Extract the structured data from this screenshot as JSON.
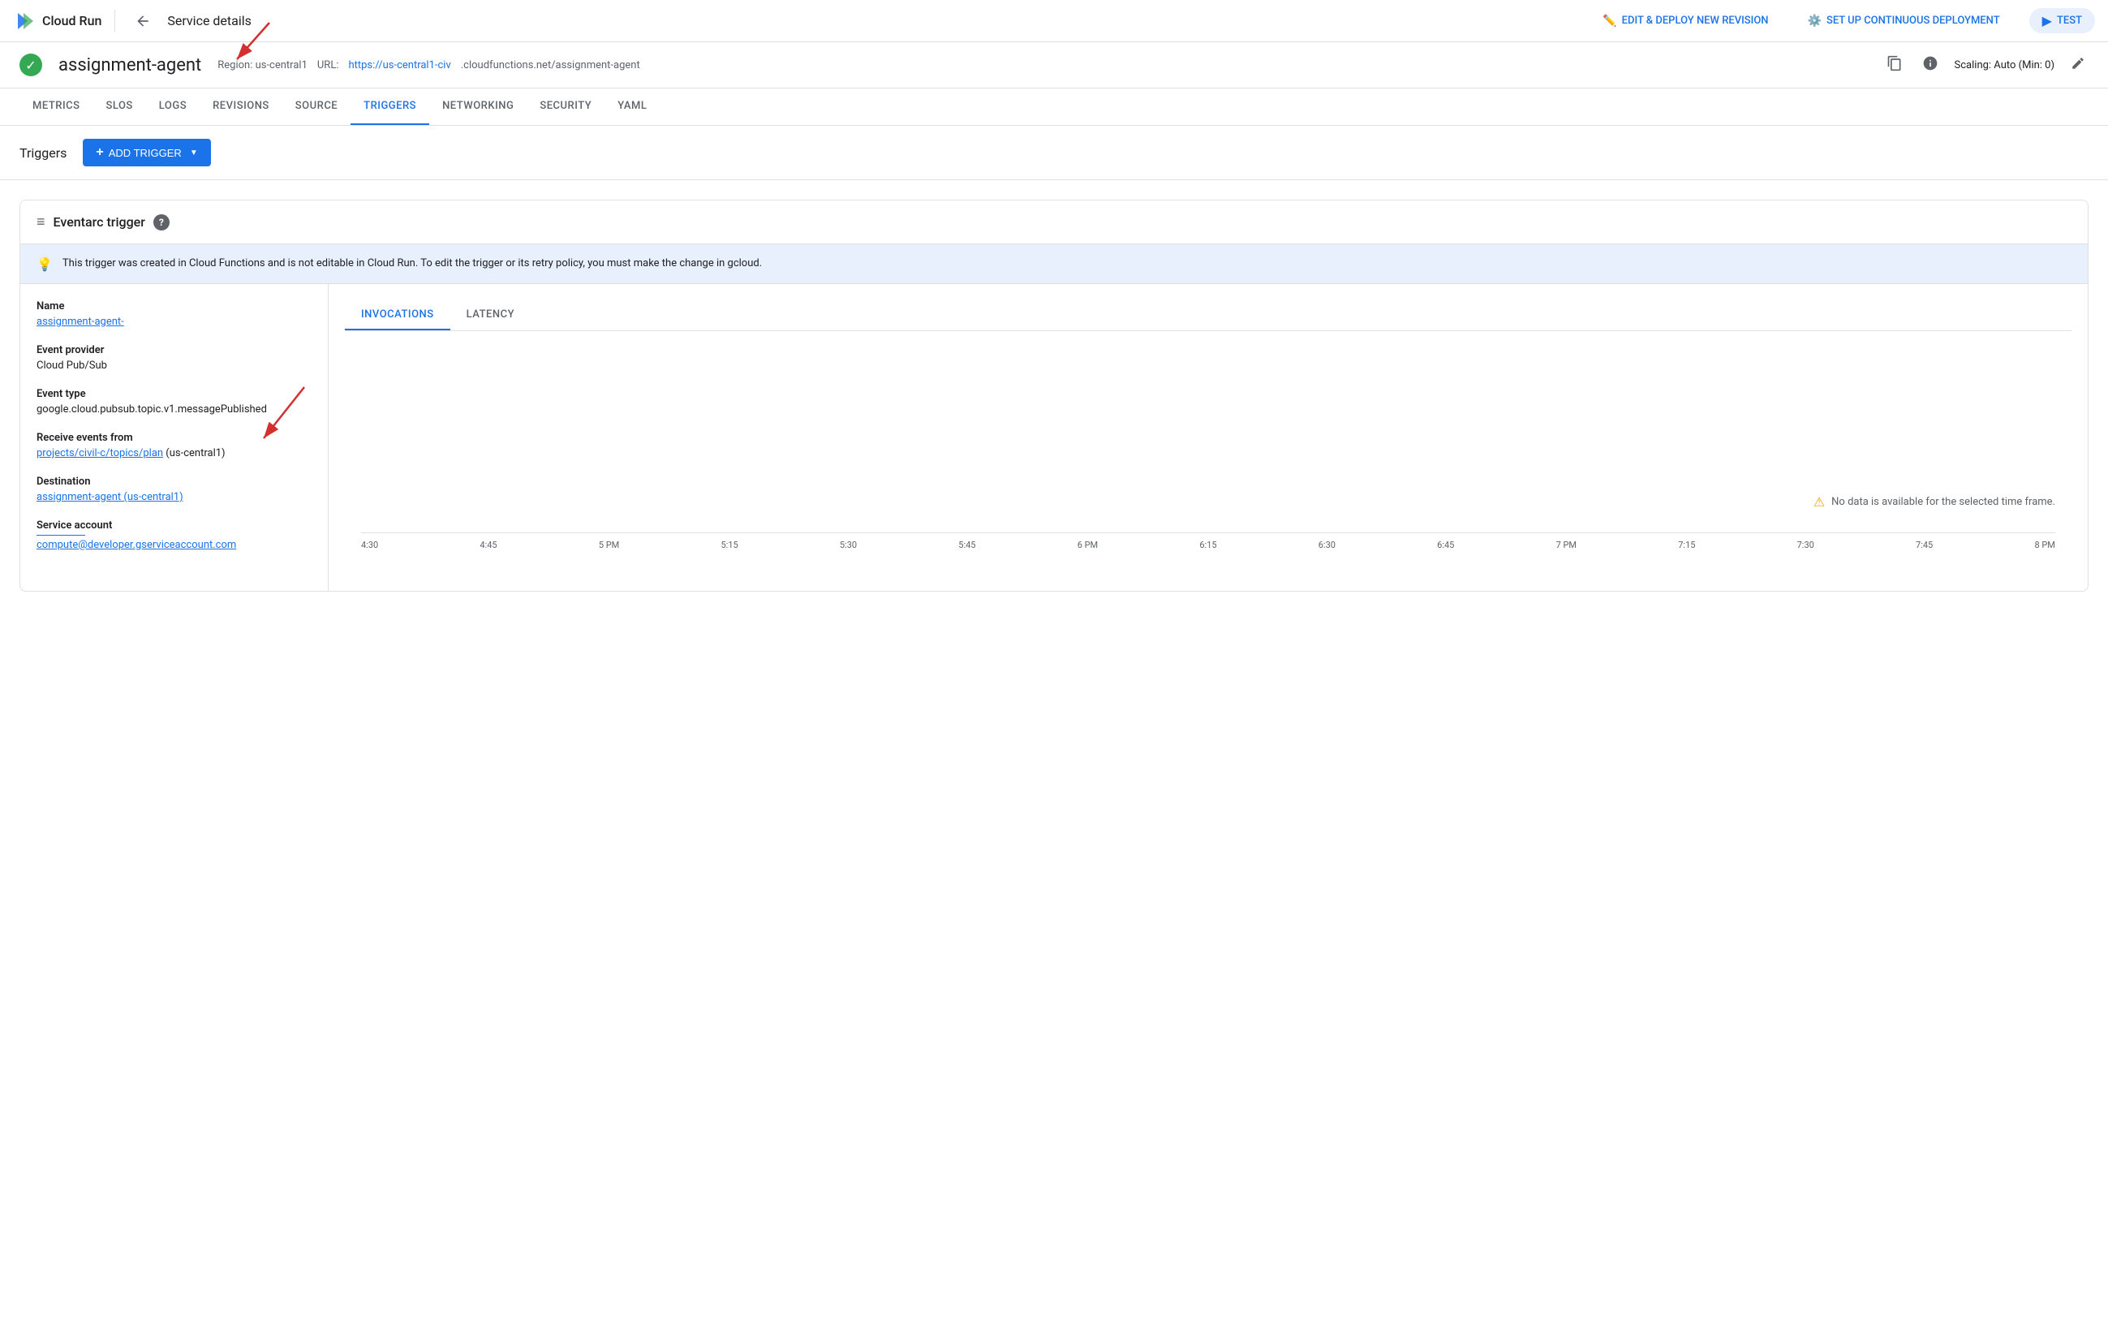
{
  "topNav": {
    "appName": "Cloud Run",
    "pageTitle": "Service details",
    "backAriaLabel": "Back",
    "actions": [
      {
        "id": "edit-deploy",
        "label": "EDIT & DEPLOY NEW REVISION",
        "icon": "✏️"
      },
      {
        "id": "continuous-deploy",
        "label": "SET UP CONTINUOUS DEPLOYMENT",
        "icon": "⚙️"
      },
      {
        "id": "test",
        "label": "TEST",
        "icon": "▶"
      }
    ]
  },
  "service": {
    "name": "assignment-agent",
    "status": "healthy",
    "region": "Region: us-central1",
    "urlLabel": "URL:",
    "urlDisplay": "https://us-central1-civ",
    "urlSuffix": ".cloudfunctions.net/assignment-agent",
    "scaling": "Scaling: Auto (Min: 0)"
  },
  "tabs": [
    {
      "id": "metrics",
      "label": "METRICS",
      "active": false
    },
    {
      "id": "slos",
      "label": "SLOS",
      "active": false
    },
    {
      "id": "logs",
      "label": "LOGS",
      "active": false
    },
    {
      "id": "revisions",
      "label": "REVISIONS",
      "active": false
    },
    {
      "id": "source",
      "label": "SOURCE",
      "active": false
    },
    {
      "id": "triggers",
      "label": "TRIGGERS",
      "active": true
    },
    {
      "id": "networking",
      "label": "NETWORKING",
      "active": false
    },
    {
      "id": "security",
      "label": "SECURITY",
      "active": false
    },
    {
      "id": "yaml",
      "label": "YAML",
      "active": false
    }
  ],
  "triggersSection": {
    "title": "Triggers",
    "addButtonLabel": "ADD TRIGGER"
  },
  "eventarcTrigger": {
    "title": "Eventarc trigger",
    "infoBanner": "This trigger was created in Cloud Functions and is not editable in Cloud Run. To edit the trigger or its retry policy, you must make the change in gcloud.",
    "details": {
      "name": {
        "label": "Name",
        "value": "assignment-agent-"
      },
      "eventProvider": {
        "label": "Event provider",
        "value": "Cloud Pub/Sub"
      },
      "eventType": {
        "label": "Event type",
        "value": "google.cloud.pubsub.topic.v1.messagePublished"
      },
      "receiveEventsFrom": {
        "label": "Receive events from",
        "linkPart": "projects/civil-c",
        "slashTopics": "/topics/plan",
        "suffix": " (us-central1)"
      },
      "destination": {
        "label": "Destination",
        "value": "assignment-agent (us-central1)"
      },
      "serviceAccount": {
        "label": "Service account",
        "value": "compute@developer.gserviceaccount.com"
      }
    },
    "chartTabs": [
      {
        "id": "invocations",
        "label": "INVOCATIONS",
        "active": true
      },
      {
        "id": "latency",
        "label": "LATENCY",
        "active": false
      }
    ],
    "noDataMessage": "No data is available for the selected time frame.",
    "timeLabels": [
      "4:30",
      "4:45",
      "5 PM",
      "5:15",
      "5:30",
      "5:45",
      "6 PM",
      "6:15",
      "6:30",
      "6:45",
      "7 PM",
      "7:15",
      "7:30",
      "7:45",
      "8 PM"
    ]
  },
  "colors": {
    "primary": "#1a73e8",
    "success": "#34a853",
    "warning": "#f9ab00",
    "text_secondary": "#5f6368"
  }
}
